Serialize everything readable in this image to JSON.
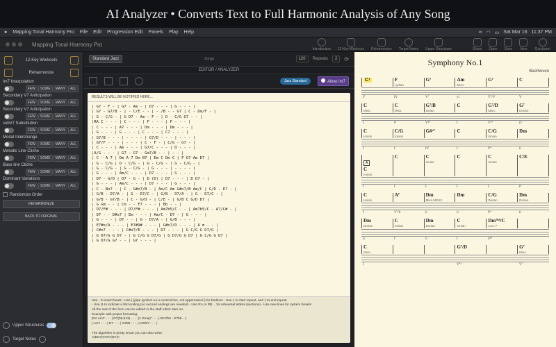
{
  "hero": "AI Analyzer • Converts Text to Full Harmonic Analysis of Any Song",
  "menubar": {
    "app": "Mapping Tonal Harmony Pro",
    "items": [
      "File",
      "Edit",
      "Progression Edit",
      "Panels",
      "Play",
      "Help"
    ],
    "right": [
      "Sat Mar 16",
      "11:37 PM"
    ]
  },
  "toolbar": {
    "title": "Mapping Tonal Harmony Pro",
    "right_tools": [
      "Introduction",
      "12-Key Workouts",
      "Reharmonize",
      "Target Notes",
      "Upper Structures",
      "Share",
      "Open",
      "Save",
      "New",
      "Quickstart"
    ]
  },
  "sidebar": {
    "top": {
      "label": "12-Key Workouts",
      "reharm": "Reharmonize"
    },
    "rows": [
      {
        "label": "Im7 Interpolation",
        "seg": [
          "FEW",
          "SOME",
          "MANY",
          "ALL"
        ]
      },
      {
        "label": "Secondary V7 Anticipation",
        "seg": [
          "FEW",
          "SOME",
          "MANY",
          "ALL"
        ]
      },
      {
        "label": "Secondary V7 Anticipation",
        "seg": [
          "FEW",
          "SOME",
          "MANY",
          "ALL"
        ]
      },
      {
        "label": "subV7 Substitution",
        "seg": [
          "FEW",
          "SOME",
          "MANY",
          "ALL"
        ]
      },
      {
        "label": "Modal Interchange",
        "seg": [
          "FEW",
          "SOME",
          "MANY",
          "ALL"
        ]
      },
      {
        "label": "Melodic Line Cliche",
        "seg": [
          "FEW",
          "SOME",
          "MANY",
          "ALL"
        ]
      },
      {
        "label": "Bass-line Cliche",
        "seg": [
          "FEW",
          "SOME",
          "MANY",
          "ALL"
        ]
      },
      {
        "label": "Dominant Variations",
        "seg": [
          "FEW",
          "SOME",
          "MANY",
          "ALL"
        ]
      }
    ],
    "randomize": "Randomize Order",
    "reharm_btn": "REHARMONIZE",
    "back_btn": "BACK TO ORIGINAL",
    "upper": "Upper Structures",
    "target": "Target Notes"
  },
  "editor": {
    "top": {
      "style": "Standard Jazz",
      "songs_label": "Songs",
      "tempo": "120",
      "repeats_label": "Repeats",
      "repeats": "2"
    },
    "window_title": "EDITOR / ANALYZER",
    "jazz_standard": "Jazz Standard",
    "allow_im7": "Allow Im7",
    "notice": "RESULTS WILL BE NOTIFIED HERE...",
    "body": "| G7 - F - | G7 - Am - | D7 - - - | G - - - |\n| G7 - G7/B - | - C/E - - | - /B - - G7 | C - Dm/F - |\n| G - C/G - | G D7 - Am - F - | D - C/G G7 - - |\n|RA C - - - | C - - - | F - - - | F - - - |\n| C - - - | A7 - - - | Dm - - - | Dm - - - |\n| G - - - | G - - - | C - - - | C7 - - - |\n| G7/B - - - | - - - - | G7/D - - - | - - - |\n| G7/F - - - | - - - | C - F - | C/G - G7 - |\n| C - - - | Am - - - | G7/C - - - | D - - - |\n|A/G - - - | G7 - G7 - Gm7/B - - | - - |\n| C - A 7 | Dm A 7 Dm B7 | Em C Dm C | F G7 Am D7 |\n| G - C/G | D - C/G - | G - C/G - | G - C/G - |\n| G - C/G - | G - C/G - | G - - - | - - - - |\n| G - - - | Am/C - - - | D7 - - - | G - - - |\n| D7 - G/D | D7 - G - | D (D) | D7 - - - | D D7 - |\n| G - - - | Am/C - - - | D7 - - - | G - - - |\n| C - Bo7 - | C - G#o7/B - | Am/C Am G#o7/B Am/C | G/D - D7 - |\n| G/B - D7/A - | G - D7/C - | G/B - D7/A - | G - D7/C - |\n| G/B - G7/B - | C - G/D - | C/E - | G/B C G/D D7 |\n| G Gm - - | Cm - - F7 - - - | Bb - - |\n| D7/F# - - - | D7/F# - - - | Am7b5/C - - | Am7b5/C - A7/C# - |\n| D7 - - D#o7 | Em - - - | Am/C - D7 - | G - - - |\n| G - - - | D7 - - | G - D7/A - | G/B - - - |\n| E7#o/A - - - | E7#9# - - - | G#o7/D - - - | A m - - |\n| C#o7 - - - | C#o7/E - - - | D7 - - - | G C/G G D7/G |\n| G D7/G G D7 - | G C/G G D7/G | G D7/G G D7 | G C/G G D7 |\n| G D7/G G7 - - | G7 - - - |",
    "help": "Use - to insert beats - Use | (pipe symbol a.k.a vertical line, not uppercased i) for barlines - Use |: to start repeat, and :| to end repeat\n- Use |1 to indicate a first ending (no second endings are needed) - Use RA or RB… for rehearsal letters (sections) - Use new lines for system breaks\nAll the rest of the form can be edited in the staff editor later on.\nExample with proper formating:\n|RA Am7 - - - | D7(b9,b13) - - - :|1 Gmaj7 - - - | Bm7b5 - E7b9 - :|\n| Am7 - - - | D7 - - - | G699 - - - | A2#5/7 - - - |\n\nThe algorithm is pretty smart you can also write:\nA|Bm7|C#m7|E7|A"
  },
  "notation": {
    "title": "Symphony No.1",
    "composer": "Beethoven",
    "systems": [
      {
        "chords": [
          "C⁷",
          "F",
          "G⁷",
          "Am",
          "G⁷",
          "C"
        ],
        "modes": [
          "",
          "Lydian",
          "",
          "Mixo.",
          "",
          ""
        ],
        "roman": [
          "I⁷",
          "IV",
          "V⁷",
          "vi",
          "V⁷/V",
          "V"
        ],
        "hl": 0
      },
      {
        "chords": [
          "C",
          "C",
          "G⁷/B",
          "C",
          "G⁷/D",
          "G⁷"
        ],
        "modes": [
          "Mixo.",
          "Mixo.",
          "Ionian",
          "",
          "Mixo.",
          "Dorian"
        ],
        "roman": [
          "I",
          "I⁶",
          "V⁶⁵",
          "I",
          "V⁴³",
          "ii⁷"
        ]
      },
      {
        "chords": [
          "C",
          "C/G",
          "G#ᵒ⁷",
          "C",
          "C/G",
          "Dm"
        ],
        "modes": [
          "Ionian",
          "Ionian",
          "",
          "",
          "Ionian",
          ""
        ],
        "roman": [
          "I",
          "I",
          "IV",
          "I",
          "I⁶⁴",
          "ii"
        ]
      },
      {
        "chords": [
          "C",
          "C",
          "C",
          "C",
          "C",
          "C/E"
        ],
        "modes": [
          "Ionian",
          "",
          "Ionian",
          "",
          "Ionian",
          ""
        ],
        "roman": [
          "I",
          "I",
          "I",
          "I",
          "I",
          "I⁶"
        ],
        "boxed": "A"
      },
      {
        "chords": [
          "C",
          "A⁷",
          "Dm",
          "Dm",
          "C/G",
          "Dm"
        ],
        "modes": [
          "Ionian",
          "",
          "Mixo.b9b13",
          "",
          "Dorian",
          "Dorian"
        ],
        "roman": [
          "I",
          "V⁷/ii",
          "ii",
          "ii",
          "I⁶⁴",
          "ii"
        ]
      },
      {
        "chords": [
          "Dm",
          "C",
          "Dm",
          "C",
          "Dm⁷ᵇ⁶/C",
          ""
        ],
        "modes": [
          "Dorian",
          "Ionian",
          "Dorian",
          "Ionian",
          "Locr.♮⁵",
          ""
        ],
        "roman": [
          "ii",
          "I",
          "ii",
          "I",
          "ii⁴²",
          ""
        ]
      },
      {
        "chords": [
          "C",
          "",
          "",
          "G⁷/D",
          "",
          "G⁷"
        ],
        "modes": [
          "Mixo.",
          "",
          "",
          "",
          "",
          "Mixo."
        ],
        "roman": [
          "I",
          "",
          "",
          "V⁴³",
          "",
          "V⁷"
        ]
      }
    ]
  }
}
